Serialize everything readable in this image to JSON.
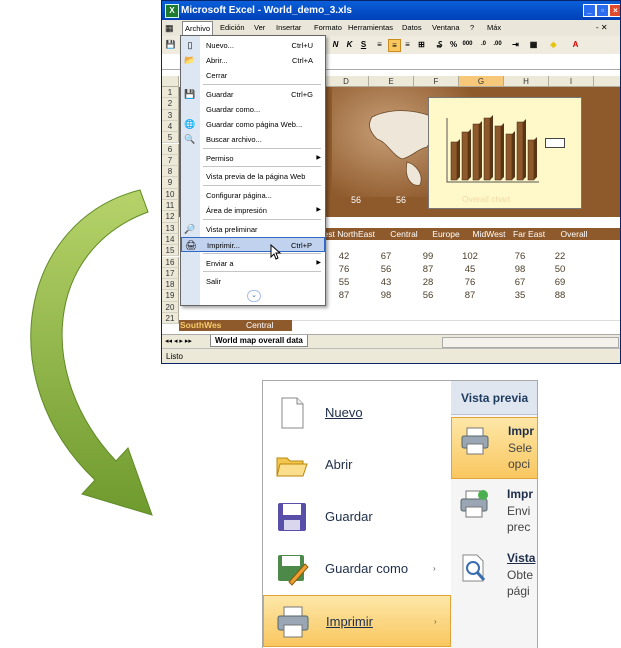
{
  "excel2003": {
    "title": "Microsoft Excel - World_demo_3.xls",
    "menubar": [
      "Archivo",
      "Edición",
      "Ver",
      "Insertar",
      "Formato",
      "Herramientas",
      "Datos",
      "Ventana",
      "?",
      "Máx"
    ],
    "active_menu": "Archivo",
    "columns": [
      "D",
      "E",
      "F",
      "G",
      "H",
      "I"
    ],
    "selected_column": "G",
    "rows": [
      "1",
      "2",
      "3",
      "4",
      "5",
      "6",
      "7",
      "8",
      "9",
      "10",
      "11",
      "12",
      "13",
      "14",
      "15",
      "16",
      "17",
      "18",
      "19",
      "20",
      "21"
    ],
    "row10_values": [
      "56",
      "56"
    ],
    "chart_title": "Overall chart",
    "region_headers": [
      "est NorthEast",
      "Central",
      "Europe",
      "MidWest",
      "Far East",
      "Overall"
    ],
    "table_rows": [
      [
        "42",
        "67",
        "99",
        "102",
        "76",
        "22"
      ],
      [
        "76",
        "56",
        "87",
        "45",
        "98",
        "50"
      ],
      [
        "55",
        "43",
        "28",
        "76",
        "67",
        "69"
      ],
      [
        "87",
        "98",
        "56",
        "87",
        "35",
        "88"
      ]
    ],
    "row20_labels": [
      "SouthWes",
      "Central"
    ],
    "sheet_tab": "World map overall data",
    "status": "Listo",
    "file_menu": [
      {
        "label": "Nuevo...",
        "shortcut": "Ctrl+U",
        "icon": "new-document-icon"
      },
      {
        "label": "Abrir...",
        "shortcut": "Ctrl+A",
        "icon": "open-folder-icon"
      },
      {
        "label": "Cerrar",
        "shortcut": "",
        "icon": ""
      },
      {
        "label": "Guardar",
        "shortcut": "Ctrl+G",
        "icon": "save-icon"
      },
      {
        "label": "Guardar como...",
        "shortcut": "",
        "icon": ""
      },
      {
        "label": "Guardar como página Web...",
        "shortcut": "",
        "icon": "web-page-icon"
      },
      {
        "label": "Buscar archivo...",
        "shortcut": "",
        "icon": "search-file-icon"
      },
      {
        "label": "Permiso",
        "shortcut": "",
        "icon": "",
        "submenu": true
      },
      {
        "label": "Vista previa de la página Web",
        "shortcut": "",
        "icon": ""
      },
      {
        "label": "Configurar página...",
        "shortcut": "",
        "icon": ""
      },
      {
        "label": "Área de impresión",
        "shortcut": "",
        "icon": "",
        "submenu": true
      },
      {
        "label": "Vista preliminar",
        "shortcut": "",
        "icon": "print-preview-icon"
      },
      {
        "label": "Imprimir...",
        "shortcut": "Ctrl+P",
        "icon": "printer-icon",
        "highlighted": true
      },
      {
        "label": "Enviar a",
        "shortcut": "",
        "icon": "",
        "submenu": true
      },
      {
        "label": "Salir",
        "shortcut": "",
        "icon": ""
      }
    ]
  },
  "excel2007": {
    "left_items": [
      {
        "label": "Nuevo",
        "icon": "new-document-icon"
      },
      {
        "label": "Abrir",
        "icon": "open-folder-icon"
      },
      {
        "label": "Guardar",
        "icon": "save-disk-icon"
      },
      {
        "label": "Guardar como",
        "icon": "save-as-icon",
        "submenu": true
      },
      {
        "label": "Imprimir",
        "icon": "printer-icon",
        "submenu": true,
        "highlighted": true
      }
    ],
    "right_header": "Vista previa",
    "right_items": [
      {
        "title": "Impr",
        "lines": [
          "Sele",
          "opci"
        ],
        "icon": "printer-icon",
        "highlighted": true
      },
      {
        "title": "Impr",
        "lines": [
          "Envi",
          "prec"
        ],
        "icon": "quick-print-icon"
      },
      {
        "title": "Vista",
        "lines": [
          "Obte",
          "pági"
        ],
        "icon": "print-preview-icon"
      }
    ]
  },
  "colors": {
    "arrow": "#7ea73a",
    "brown": "#8e5a2c",
    "highlight": "#f9c760"
  }
}
